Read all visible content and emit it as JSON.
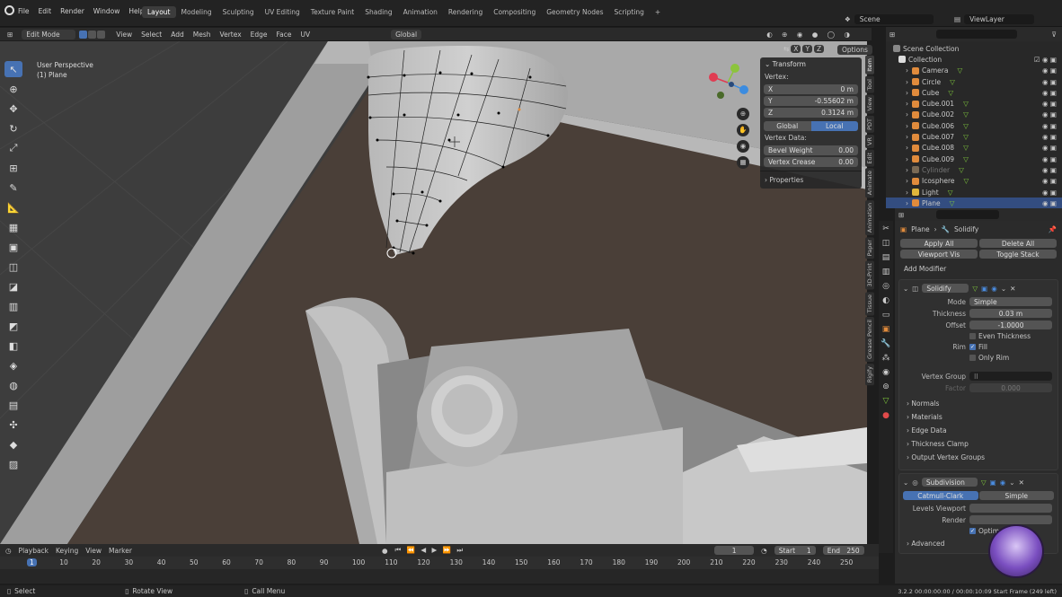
{
  "menubar": {
    "items": [
      "File",
      "Edit",
      "Render",
      "Window",
      "Help"
    ],
    "workspaces": [
      "Layout",
      "Modeling",
      "Sculpting",
      "UV Editing",
      "Texture Paint",
      "Shading",
      "Animation",
      "Rendering",
      "Compositing",
      "Geometry Nodes",
      "Scripting"
    ],
    "active_workspace": "Layout",
    "add_tab": "+",
    "scene": "Scene",
    "view_layer": "ViewLayer"
  },
  "viewport_header": {
    "mode": "Edit Mode",
    "menus": [
      "View",
      "Select",
      "Add",
      "Mesh",
      "Vertex",
      "Edge",
      "Face",
      "UV"
    ],
    "orientation": "Global",
    "options": "Options"
  },
  "viewport": {
    "perspective": "User Perspective",
    "object": "(1) Plane",
    "axis_x": "X",
    "axis_y": "Y",
    "axis_z": "Z"
  },
  "npanel": {
    "title": "Transform",
    "vertex_label": "Vertex:",
    "x_label": "X",
    "x_value": "0 m",
    "y_label": "Y",
    "y_value": "-0.55602 m",
    "z_label": "Z",
    "z_value": "0.3124 m",
    "global": "Global",
    "local": "Local",
    "vertex_data": "Vertex Data:",
    "bevel_weight": "Bevel Weight",
    "bevel_value": "0.00",
    "vertex_crease": "Vertex Crease",
    "crease_value": "0.00",
    "properties": "Properties"
  },
  "side_tabs": [
    "Item",
    "Tool",
    "View",
    "PDT",
    "VR",
    "Edit",
    "Animate",
    "Animation",
    "Paper",
    "3D-Print",
    "Tissue",
    "Grease Pencil",
    "Rigify"
  ],
  "outliner": {
    "scene_collection": "Scene Collection",
    "collection": "Collection",
    "items": [
      {
        "name": "Camera",
        "color": "#e08b3c"
      },
      {
        "name": "Circle",
        "color": "#e08b3c"
      },
      {
        "name": "Cube",
        "color": "#e08b3c"
      },
      {
        "name": "Cube.001",
        "color": "#e08b3c"
      },
      {
        "name": "Cube.002",
        "color": "#e08b3c"
      },
      {
        "name": "Cube.006",
        "color": "#e08b3c"
      },
      {
        "name": "Cube.007",
        "color": "#e08b3c"
      },
      {
        "name": "Cube.008",
        "color": "#e08b3c"
      },
      {
        "name": "Cube.009",
        "color": "#e08b3c"
      },
      {
        "name": "Cylinder",
        "color": "#7a6a55"
      },
      {
        "name": "Icosphere",
        "color": "#e08b3c"
      },
      {
        "name": "Light",
        "color": "#e0b63c"
      },
      {
        "name": "Plane",
        "color": "#e08b3c"
      }
    ]
  },
  "properties": {
    "breadcrumb_object": "Plane",
    "breadcrumb_modifier": "Solidify",
    "apply_all": "Apply All",
    "delete_all": "Delete All",
    "viewport_vis": "Viewport Vis",
    "toggle_stack": "Toggle Stack",
    "add_modifier": "Add Modifier",
    "solidify": {
      "name": "Solidify",
      "mode_label": "Mode",
      "mode_value": "Simple",
      "thickness_label": "Thickness",
      "thickness_value": "0.03 m",
      "offset_label": "Offset",
      "offset_value": "-1.0000",
      "even_thickness": "Even Thickness",
      "rim_label": "Rim",
      "fill": "Fill",
      "only_rim": "Only Rim",
      "vertex_group_label": "Vertex Group",
      "factor_label": "Factor",
      "factor_value": "0.000",
      "sections": [
        "Normals",
        "Materials",
        "Edge Data",
        "Thickness Clamp",
        "Output Vertex Groups"
      ]
    },
    "subdivision": {
      "name": "Subdivision",
      "catmull": "Catmull-Clark",
      "simple": "Simple",
      "levels_viewport": "Levels Viewport",
      "render": "Render",
      "optimal": "Optim",
      "advanced": "Advanced"
    }
  },
  "timeline": {
    "menus": [
      "Playback",
      "Keying",
      "View",
      "Marker"
    ],
    "current_frame": "1",
    "start_label": "Start",
    "start_value": "1",
    "end_label": "End",
    "end_value": "250",
    "ticks": [
      "1",
      "10",
      "20",
      "30",
      "40",
      "50",
      "60",
      "70",
      "80",
      "90",
      "100",
      "110",
      "120",
      "130",
      "140",
      "150",
      "160",
      "170",
      "180",
      "190",
      "200",
      "210",
      "220",
      "230",
      "240",
      "250"
    ]
  },
  "statusbar": {
    "select": "Select",
    "rotate": "Rotate View",
    "call_menu": "Call Menu",
    "version": "3.2.2  00:00:00:00 / 00:00:10:09  Start Frame (249 left)"
  }
}
